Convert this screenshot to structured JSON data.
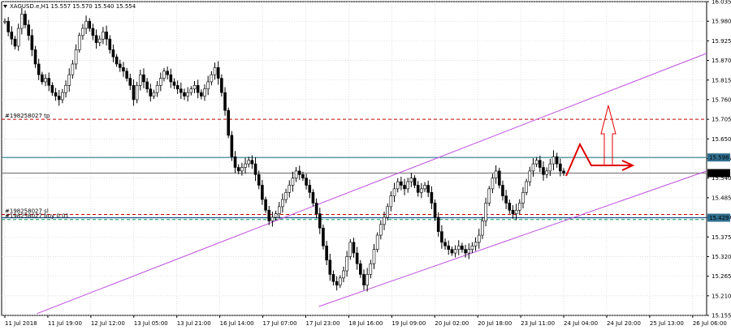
{
  "header": {
    "symbol_text": "XAGUSD.e,H1  15.557 15.570 15.540 15.554"
  },
  "chart_data": {
    "type": "candlestick",
    "ylim": [
      15.155,
      16.035
    ],
    "y_ticks": [
      "16.035",
      "15.980",
      "15.925",
      "15.870",
      "15.815",
      "15.760",
      "15.705",
      "15.650",
      "15.595",
      "15.540",
      "15.485",
      "15.430",
      "15.375",
      "15.320",
      "15.265",
      "15.210",
      "15.155"
    ],
    "x_ticks": [
      "11 Jul 2018",
      "11 Jul 19:00",
      "12 Jul 12:00",
      "13 Jul 05:00",
      "13 Jul 21:00",
      "16 Jul 14:00",
      "17 Jul 07:00",
      "17 Jul 23:00",
      "18 Jul 16:00",
      "19 Jul 09:00",
      "20 Jul 02:00",
      "20 Jul 18:00",
      "23 Jul 11:00",
      "24 Jul 04:00",
      "24 Jul 20:00",
      "25 Jul 13:00",
      "26 Jul 06:00"
    ],
    "close_series": [
      15.98,
      15.95,
      15.93,
      15.91,
      15.96,
      16.0,
      15.97,
      15.94,
      15.9,
      15.86,
      15.83,
      15.81,
      15.82,
      15.8,
      15.78,
      15.77,
      15.76,
      15.78,
      15.8,
      15.83,
      15.86,
      15.9,
      15.94,
      15.96,
      15.98,
      15.96,
      15.94,
      15.92,
      15.93,
      15.95,
      15.93,
      15.9,
      15.88,
      15.86,
      15.85,
      15.84,
      15.82,
      15.8,
      15.76,
      15.8,
      15.83,
      15.81,
      15.79,
      15.77,
      15.78,
      15.8,
      15.82,
      15.84,
      15.83,
      15.81,
      15.8,
      15.79,
      15.78,
      15.77,
      15.78,
      15.79,
      15.8,
      15.78,
      15.77,
      15.79,
      15.81,
      15.83,
      15.85,
      15.82,
      15.78,
      15.73,
      15.66,
      15.6,
      15.57,
      15.56,
      15.57,
      15.58,
      15.59,
      15.58,
      15.55,
      15.52,
      15.48,
      15.45,
      15.42,
      15.43,
      15.44,
      15.46,
      15.48,
      15.5,
      15.52,
      15.54,
      15.56,
      15.55,
      15.54,
      15.52,
      15.5,
      15.47,
      15.44,
      15.4,
      15.35,
      15.31,
      15.27,
      15.25,
      15.24,
      15.26,
      15.28,
      15.32,
      15.36,
      15.33,
      15.3,
      15.27,
      15.24,
      15.27,
      15.3,
      15.34,
      15.38,
      15.41,
      15.43,
      15.46,
      15.49,
      15.51,
      15.53,
      15.52,
      15.51,
      15.53,
      15.54,
      15.52,
      15.5,
      15.51,
      15.52,
      15.5,
      15.47,
      15.43,
      15.39,
      15.36,
      15.35,
      15.34,
      15.33,
      15.34,
      15.35,
      15.34,
      15.33,
      15.34,
      15.35,
      15.36,
      15.38,
      15.42,
      15.47,
      15.51,
      15.54,
      15.56,
      15.52,
      15.49,
      15.47,
      15.45,
      15.44,
      15.45,
      15.47,
      15.5,
      15.53,
      15.56,
      15.58,
      15.59,
      15.57,
      15.55,
      15.56,
      15.58,
      15.6,
      15.58,
      15.56,
      15.554
    ],
    "levels": [
      {
        "price": 15.598,
        "label": "15.598",
        "color": "#2f7f8f",
        "style": "solid"
      },
      {
        "price": 15.554,
        "label": "15.554",
        "color": "#7f7f7f",
        "style": "solid"
      },
      {
        "price": 15.429,
        "label": "15.429",
        "color": "#1f4f8f",
        "style": "solid"
      },
      {
        "price": 15.705,
        "label": "#198258027 tp",
        "color": "#c00000",
        "style": "dash"
      },
      {
        "price": 15.438,
        "label": "#198258027 sl",
        "color": "#c00000",
        "style": "dash"
      },
      {
        "price": 15.424,
        "label": "#198258027 buy 0.01",
        "color": "#00a050",
        "style": "dash"
      }
    ],
    "channel": [
      {
        "x": [
          0.05,
          1.0
        ],
        "y": [
          15.16,
          15.89
        ]
      },
      {
        "x": [
          0.45,
          1.0
        ],
        "y": [
          15.18,
          15.56
        ]
      }
    ],
    "colors": {
      "candle": "#000000",
      "channel": "#c050e0",
      "forecast": "#e00000",
      "badge": "#2f6f8f"
    }
  }
}
